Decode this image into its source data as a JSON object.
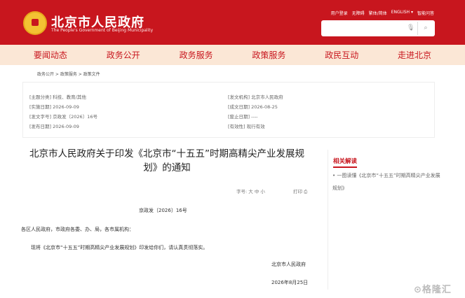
{
  "header": {
    "title": "北京市人民政府",
    "subtitle": "The People's Government of Beijing Municipality",
    "top_links": [
      "用户登录",
      "无障碍",
      "繁体/简体",
      "ENGLISH ▾",
      "智能问答"
    ]
  },
  "nav": [
    "要闻动态",
    "政务公开",
    "政务服务",
    "政策服务",
    "政民互动",
    "走进北京"
  ],
  "breadcrumb": "政务公开  >  政策服务  >  政策文件",
  "meta": {
    "left": [
      "[主题分类] 科技、教育/其他",
      "[实施日期] 2026-09-09",
      "[发文字号] 京政发〔2026〕16号",
      "[发布日期] 2026-09-09"
    ],
    "right": [
      "[发文机构] 北京市人民政府",
      "[成文日期] 2026-08-25",
      "[废止日期] ----",
      "[有效性] 现行有效"
    ]
  },
  "document": {
    "title_line1": "北京市人民政府关于印发《北京市“十五五”时期高精尖产业发展规",
    "title_line2": "划》的通知",
    "font_size": "字号:  大  中  小",
    "print": "打印 ⎙",
    "doc_number": "京政发〔2026〕16号",
    "salutation": "各区人民政府，市政府各委、办、局，各市属机构：",
    "body": "现将《北京市“十五五”时期高精尖产业发展规划》印发给你们，请认真贯彻落实。",
    "signature": "北京市人民政府",
    "date": "2026年8月25日"
  },
  "related": {
    "title": "相关解读",
    "link": "• 一图读懂《北京市“十五五”时期高精尖产业发展规划》"
  },
  "watermark": "⊙格隆汇"
}
